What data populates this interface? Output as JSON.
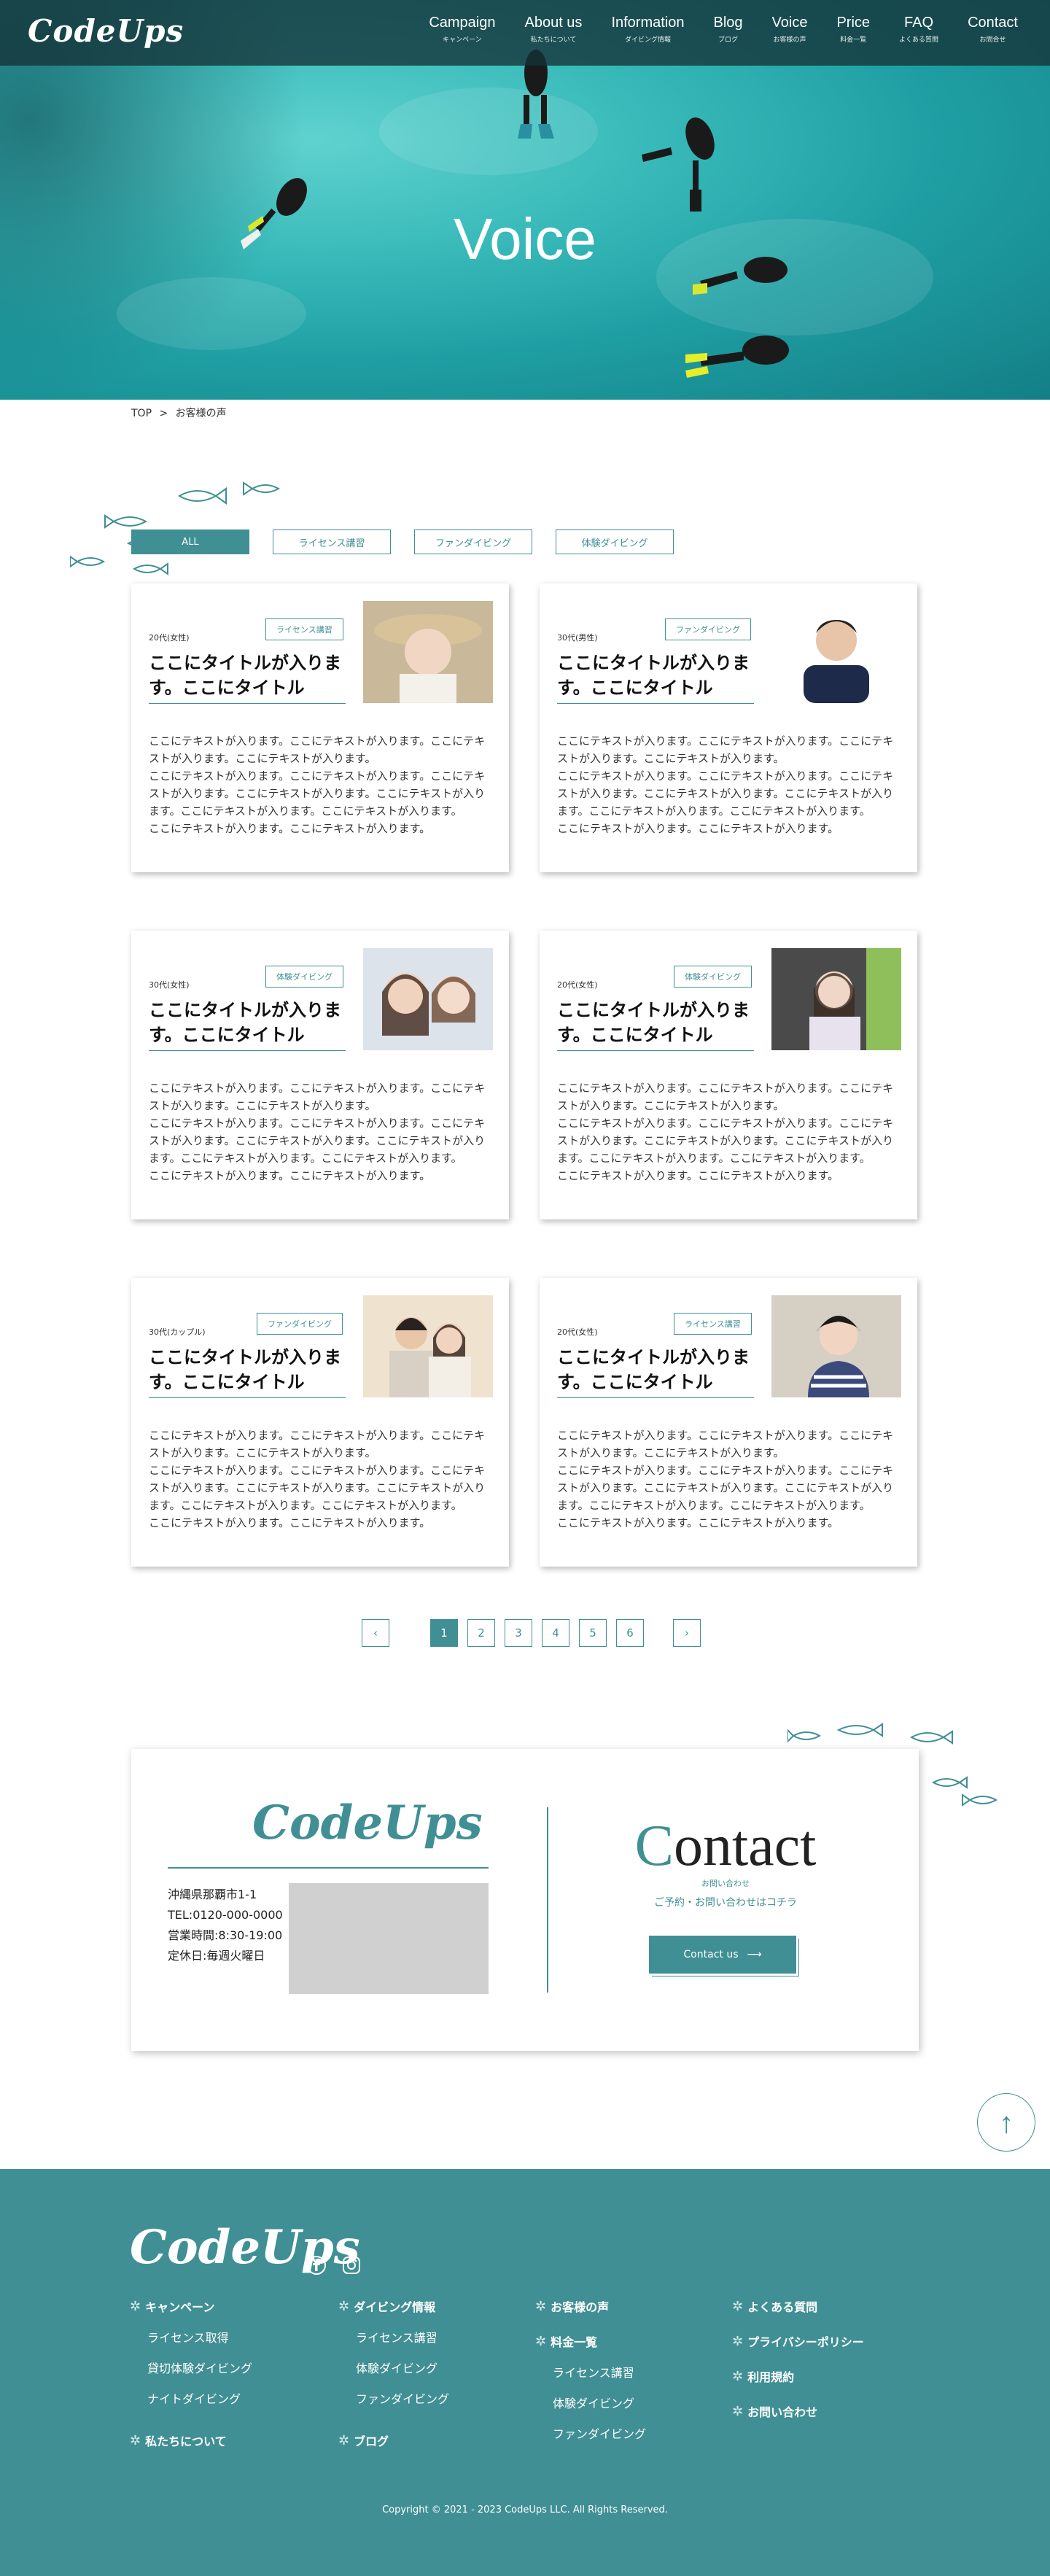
{
  "header": {
    "logo": "CodeUps",
    "nav": [
      {
        "en": "Campaign",
        "ja": "キャンペーン"
      },
      {
        "en": "About us",
        "ja": "私たちについて"
      },
      {
        "en": "Information",
        "ja": "ダイビング情報"
      },
      {
        "en": "Blog",
        "ja": "ブログ"
      },
      {
        "en": "Voice",
        "ja": "お客様の声"
      },
      {
        "en": "Price",
        "ja": "料金一覧"
      },
      {
        "en": "FAQ",
        "ja": "よくある質問"
      },
      {
        "en": "Contact",
        "ja": "お問合せ"
      }
    ]
  },
  "hero": {
    "title": "Voice"
  },
  "breadcrumb": {
    "home": "TOP",
    "separator": ">",
    "current": "お客様の声"
  },
  "filters": [
    "ALL",
    "ライセンス講習",
    "ファンダイビング",
    "体験ダイビング"
  ],
  "cards": [
    {
      "age": "20代(女性)",
      "tag": "ライセンス講習",
      "title": "ここにタイトルが入ります。ここにタイトル",
      "body": "ここにテキストが入ります。ここにテキストが入ります。ここにテキストが入ります。ここにテキストが入ります。\nここにテキストが入ります。ここにテキストが入ります。ここにテキストが入ります。ここにテキストが入ります。ここにテキストが入ります。ここにテキストが入ります。ここにテキストが入ります。\nここにテキストが入ります。ここにテキストが入ります。"
    },
    {
      "age": "30代(男性)",
      "tag": "ファンダイビング",
      "title": "ここにタイトルが入ります。ここにタイトル",
      "body": "ここにテキストが入ります。ここにテキストが入ります。ここにテキストが入ります。ここにテキストが入ります。\nここにテキストが入ります。ここにテキストが入ります。ここにテキストが入ります。ここにテキストが入ります。ここにテキストが入ります。ここにテキストが入ります。ここにテキストが入ります。\nここにテキストが入ります。ここにテキストが入ります。"
    },
    {
      "age": "30代(女性)",
      "tag": "体験ダイビング",
      "title": "ここにタイトルが入ります。ここにタイトル",
      "body": "ここにテキストが入ります。ここにテキストが入ります。ここにテキストが入ります。ここにテキストが入ります。\nここにテキストが入ります。ここにテキストが入ります。ここにテキストが入ります。ここにテキストが入ります。ここにテキストが入ります。ここにテキストが入ります。ここにテキストが入ります。\nここにテキストが入ります。ここにテキストが入ります。"
    },
    {
      "age": "20代(女性)",
      "tag": "体験ダイビング",
      "title": "ここにタイトルが入ります。ここにタイトル",
      "body": "ここにテキストが入ります。ここにテキストが入ります。ここにテキストが入ります。ここにテキストが入ります。\nここにテキストが入ります。ここにテキストが入ります。ここにテキストが入ります。ここにテキストが入ります。ここにテキストが入ります。ここにテキストが入ります。ここにテキストが入ります。\nここにテキストが入ります。ここにテキストが入ります。"
    },
    {
      "age": "30代(カップル)",
      "tag": "ファンダイビング",
      "title": "ここにタイトルが入ります。ここにタイトル",
      "body": "ここにテキストが入ります。ここにテキストが入ります。ここにテキストが入ります。ここにテキストが入ります。\nここにテキストが入ります。ここにテキストが入ります。ここにテキストが入ります。ここにテキストが入ります。ここにテキストが入ります。ここにテキストが入ります。ここにテキストが入ります。\nここにテキストが入ります。ここにテキストが入ります。"
    },
    {
      "age": "20代(女性)",
      "tag": "ライセンス講習",
      "title": "ここにタイトルが入ります。ここにタイトル",
      "body": "ここにテキストが入ります。ここにテキストが入ります。ここにテキストが入ります。ここにテキストが入ります。\nここにテキストが入ります。ここにテキストが入ります。ここにテキストが入ります。ここにテキストが入ります。ここにテキストが入ります。ここにテキストが入ります。ここにテキストが入ります。\nここにテキストが入ります。ここにテキストが入ります。"
    }
  ],
  "pagination": {
    "prev": "‹",
    "pages": [
      "1",
      "2",
      "3",
      "4",
      "5",
      "6"
    ],
    "next": "›",
    "current": "1"
  },
  "contact": {
    "logo": "CodeUps",
    "address": "沖縄県那覇市1-1",
    "tel": "TEL:0120-000-0000",
    "hours": "営業時間:8:30-19:00",
    "closed": "定休日:毎週火曜日",
    "title_first": "C",
    "title_rest": "ontact",
    "sub": "お問い合わせ",
    "note": "ご予約・お問い合わせはコチラ",
    "button": "Contact us",
    "button_arrow": "⟶"
  },
  "to_top": "↑",
  "footer": {
    "logo": "CodeUps",
    "icons": [
      "facebook-icon",
      "instagram-icon"
    ],
    "columns": [
      [
        {
          "head": "キャンペーン",
          "subs": [
            "ライセンス取得",
            "貸切体験ダイビング",
            "ナイトダイビング"
          ]
        },
        {
          "head": "私たちについて",
          "subs": []
        }
      ],
      [
        {
          "head": "ダイビング情報",
          "subs": [
            "ライセンス講習",
            "体験ダイビング",
            "ファンダイビング"
          ]
        },
        {
          "head": "ブログ",
          "subs": []
        }
      ],
      [
        {
          "head": "お客様の声",
          "subs": []
        },
        {
          "head": "料金一覧",
          "subs": [
            "ライセンス講習",
            "体験ダイビング",
            "ファンダイビング"
          ]
        }
      ],
      [
        {
          "head": "よくある質問",
          "subs": []
        },
        {
          "head": "プライバシーポリシー",
          "subs": []
        },
        {
          "head": "利用規約",
          "subs": []
        },
        {
          "head": "お問い合わせ",
          "subs": []
        }
      ]
    ],
    "copyright": "Copyright © 2021 - 2023 CodeUps LLC. All Rights Reserved."
  },
  "colors": {
    "accent": "#408f95",
    "header_bg": "#1f3c40",
    "footer_bg": "#408f95"
  }
}
